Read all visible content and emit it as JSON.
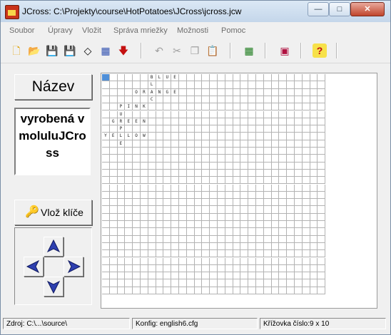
{
  "window": {
    "title": "JCross: C:\\Projekty\\course\\HotPotatoes\\JCross\\jcross.jcw"
  },
  "title_buttons": {
    "minimize": "—",
    "maximize": "□",
    "close": "✕"
  },
  "menu": [
    "Soubor",
    "Úpravy",
    "Vložit",
    "Správa mriežky",
    "Možnosti",
    "Pomoc"
  ],
  "toolbar": [
    {
      "icon": "new-file-icon",
      "glyph": "🗋"
    },
    {
      "icon": "open-folder-icon",
      "glyph": "📂"
    },
    {
      "icon": "save-icon",
      "glyph": "💾"
    },
    {
      "icon": "save-as-icon",
      "glyph": "💾"
    },
    {
      "icon": "eraser-icon",
      "glyph": "◇"
    },
    {
      "icon": "grid-export-icon",
      "glyph": "▦"
    },
    {
      "icon": "arrow-down-icon",
      "glyph": "🡇"
    },
    {
      "icon": "undo-icon",
      "glyph": "↶"
    },
    {
      "icon": "cut-icon",
      "glyph": "✂"
    },
    {
      "icon": "copy-icon",
      "glyph": "❐"
    },
    {
      "icon": "paste-icon",
      "glyph": "📋"
    },
    {
      "icon": "grid-build-icon",
      "glyph": "▦"
    },
    {
      "icon": "web-export-icon",
      "glyph": "▣"
    },
    {
      "icon": "help-icon",
      "glyph": "?"
    }
  ],
  "left_panel": {
    "name_button": "Název",
    "description": "vyrobená v moluluJCross",
    "clues_button": "Vlož klíče"
  },
  "grid": {
    "rows": 30,
    "cols": 29,
    "letters": [
      {
        "r": 0,
        "c": 6,
        "ch": "B"
      },
      {
        "r": 0,
        "c": 7,
        "ch": "L"
      },
      {
        "r": 0,
        "c": 8,
        "ch": "U"
      },
      {
        "r": 0,
        "c": 9,
        "ch": "E"
      },
      {
        "r": 1,
        "c": 6,
        "ch": "L"
      },
      {
        "r": 2,
        "c": 4,
        "ch": "O"
      },
      {
        "r": 2,
        "c": 5,
        "ch": "R"
      },
      {
        "r": 2,
        "c": 6,
        "ch": "A"
      },
      {
        "r": 2,
        "c": 7,
        "ch": "N"
      },
      {
        "r": 2,
        "c": 8,
        "ch": "G"
      },
      {
        "r": 2,
        "c": 9,
        "ch": "E"
      },
      {
        "r": 3,
        "c": 6,
        "ch": "C"
      },
      {
        "r": 4,
        "c": 2,
        "ch": "P"
      },
      {
        "r": 4,
        "c": 3,
        "ch": "I"
      },
      {
        "r": 4,
        "c": 4,
        "ch": "N"
      },
      {
        "r": 4,
        "c": 5,
        "ch": "K"
      },
      {
        "r": 5,
        "c": 2,
        "ch": "U"
      },
      {
        "r": 6,
        "c": 1,
        "ch": "G"
      },
      {
        "r": 6,
        "c": 2,
        "ch": "R"
      },
      {
        "r": 6,
        "c": 3,
        "ch": "E"
      },
      {
        "r": 6,
        "c": 4,
        "ch": "E"
      },
      {
        "r": 6,
        "c": 5,
        "ch": "N"
      },
      {
        "r": 7,
        "c": 2,
        "ch": "P"
      },
      {
        "r": 8,
        "c": 0,
        "ch": "Y"
      },
      {
        "r": 8,
        "c": 1,
        "ch": "E"
      },
      {
        "r": 8,
        "c": 2,
        "ch": "L"
      },
      {
        "r": 8,
        "c": 3,
        "ch": "L"
      },
      {
        "r": 8,
        "c": 4,
        "ch": "O"
      },
      {
        "r": 8,
        "c": 5,
        "ch": "W"
      },
      {
        "r": 9,
        "c": 2,
        "ch": "E"
      }
    ]
  },
  "status": {
    "source": "Zdroj: C:\\...\\source\\",
    "config": "Konfig: english6.cfg",
    "puzzle": "Křížovka číslo:9 x 10"
  }
}
